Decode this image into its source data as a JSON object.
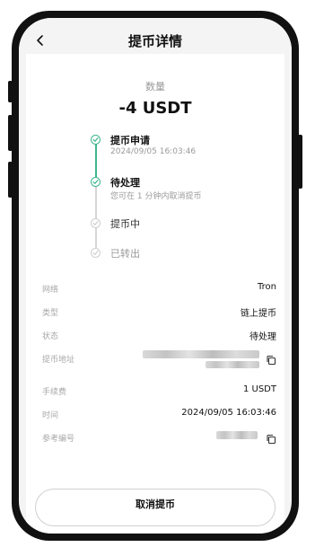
{
  "header": {
    "title": "提币详情",
    "back_icon": "chevron-left-icon"
  },
  "amount": {
    "label": "数量",
    "value": "-4 USDT"
  },
  "timeline": [
    {
      "title": "提币申请",
      "subtitle": "2024/09/05 16:03:46",
      "status": "done"
    },
    {
      "title": "待处理",
      "subtitle": "您可在 1 分钟内取消提币",
      "status": "done"
    },
    {
      "title": "提币中",
      "subtitle": "",
      "status": "pending"
    },
    {
      "title": "已转出",
      "subtitle": "",
      "status": "pending"
    }
  ],
  "details": {
    "network": {
      "label": "网络",
      "value": "Tron"
    },
    "type": {
      "label": "类型",
      "value": "链上提币"
    },
    "status": {
      "label": "状态",
      "value": "待处理"
    },
    "address": {
      "label": "提币地址"
    },
    "fee": {
      "label": "手续费",
      "value": "1 USDT"
    },
    "time": {
      "label": "时间",
      "value": "2024/09/05 16:03:46"
    },
    "reference": {
      "label": "参考编号"
    }
  },
  "actions": {
    "cancel_label": "取消提币"
  },
  "colors": {
    "accent": "#3fb58c",
    "inactive": "#cfcfcf"
  }
}
